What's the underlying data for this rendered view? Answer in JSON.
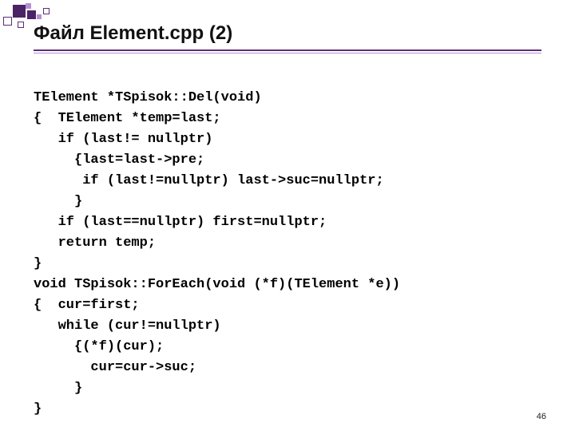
{
  "slide": {
    "title": "Файл Element.cpp (2)",
    "page_number": "46"
  },
  "code": {
    "lines": [
      "TElement *TSpisok::Del(void)",
      "{  TElement *temp=last;",
      "   if (last!= nullptr)",
      "     {last=last->pre;",
      "      if (last!=nullptr) last->suc=nullptr;",
      "     }",
      "   if (last==nullptr) first=nullptr;",
      "   return temp;",
      "}",
      "void TSpisok::ForEach(void (*f)(TElement *e))",
      "{  cur=first;",
      "   while (cur!=nullptr)",
      "     {(*f)(cur);",
      "       cur=cur->suc;",
      "     }",
      "}"
    ]
  }
}
